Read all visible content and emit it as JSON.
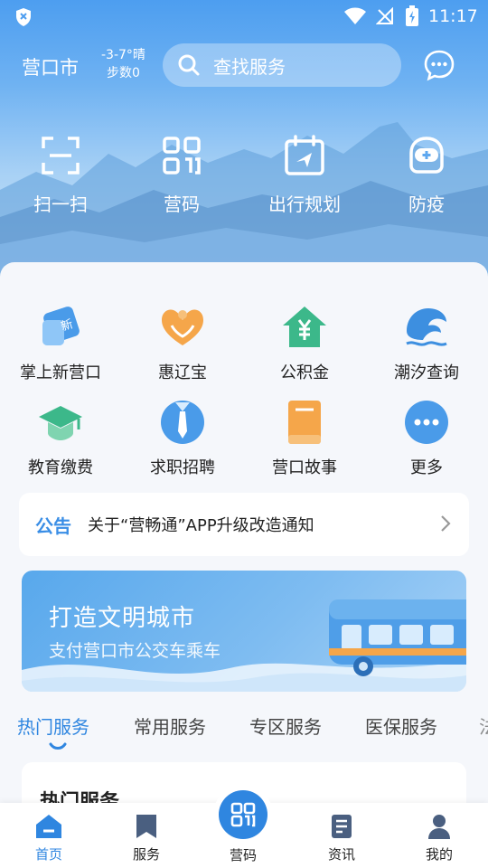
{
  "status_bar": {
    "time": "11:17"
  },
  "header": {
    "city": "营口市",
    "weather": {
      "temp": "-3-7°晴",
      "steps": "步数0"
    },
    "search_placeholder": "查找服务"
  },
  "quick_actions": [
    {
      "label": "扫一扫",
      "icon": "scan-icon"
    },
    {
      "label": "营码",
      "icon": "qr-code-icon"
    },
    {
      "label": "出行规划",
      "icon": "calendar-navigation-icon"
    },
    {
      "label": "防疫",
      "icon": "medical-helmet-icon"
    }
  ],
  "services": [
    {
      "label": "掌上新营口",
      "icon": "news-tag-icon"
    },
    {
      "label": "惠辽宝",
      "icon": "heart-hands-icon"
    },
    {
      "label": "公积金",
      "icon": "house-yuan-icon"
    },
    {
      "label": "潮汐查询",
      "icon": "wave-icon"
    },
    {
      "label": "教育缴费",
      "icon": "graduation-cap-icon"
    },
    {
      "label": "求职招聘",
      "icon": "tie-icon"
    },
    {
      "label": "营口故事",
      "icon": "book-icon"
    },
    {
      "label": "更多",
      "icon": "more-dots-icon"
    }
  ],
  "notice": {
    "tag": "公告",
    "text": "关于“营畅通”APP升级改造通知"
  },
  "banner": {
    "title": "打造文明城市",
    "subtitle": "支付营口市公交车乘车"
  },
  "tabs": [
    {
      "label": "热门服务",
      "active": true
    },
    {
      "label": "常用服务",
      "active": false
    },
    {
      "label": "专区服务",
      "active": false
    },
    {
      "label": "医保服务",
      "active": false
    },
    {
      "label": "法",
      "active": false
    }
  ],
  "hot_section_title": "热门服务",
  "bottom_nav": [
    {
      "label": "首页",
      "icon": "home-icon",
      "active": true
    },
    {
      "label": "服务",
      "icon": "bookmark-icon",
      "active": false
    },
    {
      "label": "营码",
      "icon": "qr-code-icon",
      "active": false
    },
    {
      "label": "资讯",
      "icon": "news-icon",
      "active": false
    },
    {
      "label": "我的",
      "icon": "user-icon",
      "active": false
    }
  ],
  "colors": {
    "accent": "#2f86e0",
    "hero_top": "#4d9ef0",
    "page_bg": "#f5f7fb"
  }
}
